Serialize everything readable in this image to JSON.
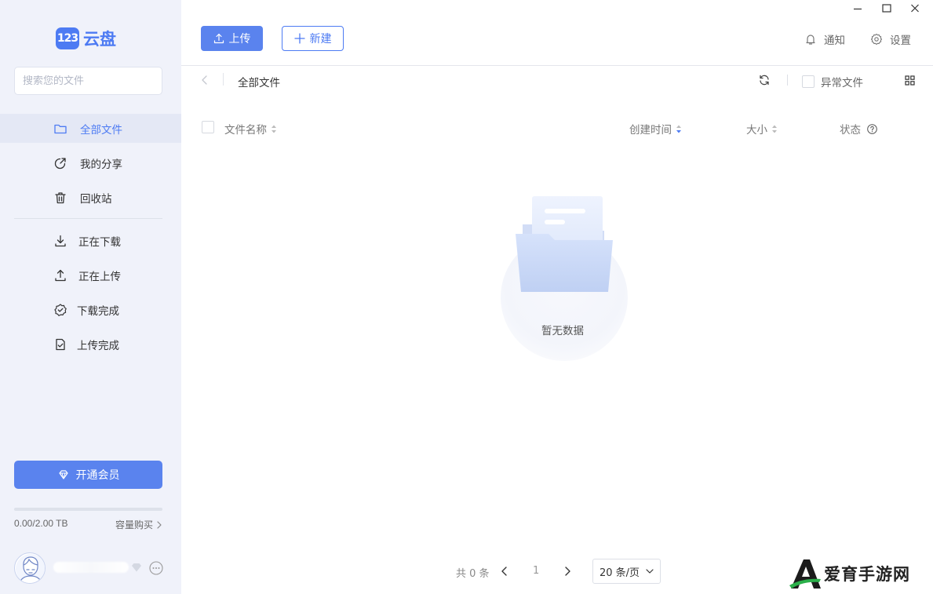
{
  "brand": {
    "logo_number": "123",
    "logo_text": "云盘"
  },
  "search": {
    "placeholder": "搜索您的文件"
  },
  "sidebar": {
    "items": [
      {
        "label": "全部文件",
        "icon": "folder-icon",
        "active": true
      },
      {
        "label": "我的分享",
        "icon": "share-icon",
        "active": false
      },
      {
        "label": "回收站",
        "icon": "trash-icon",
        "active": false
      },
      {
        "label": "正在下载",
        "icon": "download-icon",
        "active": false
      },
      {
        "label": "正在上传",
        "icon": "upload-icon",
        "active": false
      },
      {
        "label": "下载完成",
        "icon": "check-badge-icon",
        "active": false
      },
      {
        "label": "上传完成",
        "icon": "file-check-icon",
        "active": false
      }
    ],
    "vip_label": "开通会员",
    "quota": {
      "text": "0.00/2.00 TB",
      "used_fraction": 0
    },
    "buy_label": "容量购买"
  },
  "toolbar": {
    "upload_label": "上传",
    "new_label": "新建",
    "notify_label": "通知",
    "settings_label": "设置"
  },
  "breadcrumb": {
    "current": "全部文件"
  },
  "filters": {
    "abnormal_label": "异常文件"
  },
  "table": {
    "columns": {
      "name": "文件名称",
      "created": "创建时间",
      "size": "大小",
      "status": "状态"
    }
  },
  "empty": {
    "text": "暂无数据"
  },
  "pagination": {
    "total": "共 0 条",
    "page": "1",
    "page_size": "20 条/页"
  },
  "watermark": {
    "text": "爱育手游网"
  },
  "colors": {
    "accent": "#4d7bf3",
    "sidebar_bg": "#f0f2fa",
    "active_bg": "#e4e8f5"
  }
}
